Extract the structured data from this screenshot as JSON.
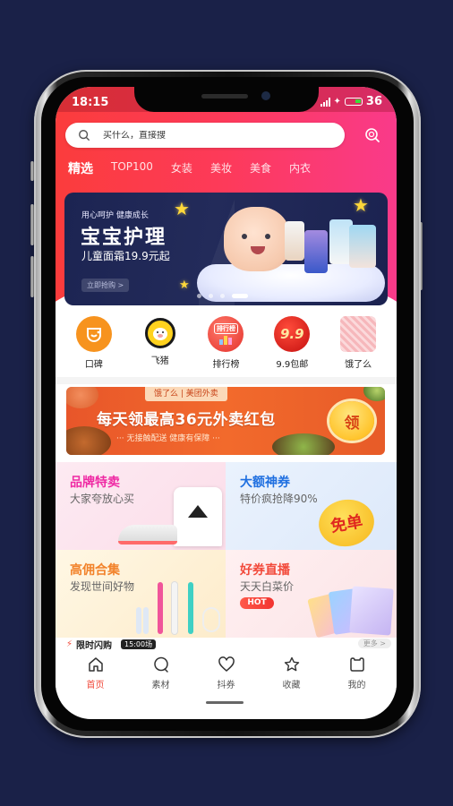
{
  "status_bar": {
    "time": "18:15",
    "battery": "36"
  },
  "search": {
    "placeholder": "买什么，直接搜"
  },
  "category_tabs": [
    {
      "label": "精选",
      "active": true
    },
    {
      "label": "TOP100"
    },
    {
      "label": "女装"
    },
    {
      "label": "美妆"
    },
    {
      "label": "美食"
    },
    {
      "label": "内衣"
    }
  ],
  "banner": {
    "eyebrow": "用心呵护 健康成长",
    "title": "宝宝护理",
    "subtitle": "儿童面霜19.9元起",
    "cta": "立即抢购 >",
    "slide_count": 4,
    "active_slide": 4
  },
  "quick_icons": [
    {
      "label": "口碑",
      "icon": "koubei-icon",
      "color": "#f7931e"
    },
    {
      "label": "飞猪",
      "icon": "fliggy-icon",
      "color": "#ffd21e"
    },
    {
      "label": "排行榜",
      "icon": "ranking-icon",
      "color": "#f2453d",
      "badge": "排行榜"
    },
    {
      "label": "9.9包邮",
      "icon": "free-shipping-icon",
      "color": "#e21d1d",
      "badge": "9.9"
    },
    {
      "label": "饿了么",
      "icon": "eleme-icon",
      "color": "#f7c3c6"
    }
  ],
  "promo": {
    "tag": "饿了么 | 美团外卖",
    "title": "每天领最高36元外卖红包",
    "subtitle": "··· 无接触配送 健康有保障 ···",
    "button": "领"
  },
  "cards": [
    {
      "title": "品牌特卖",
      "subtitle": "大家夸放心买",
      "title_color": "#ef2aa4",
      "bg": "#fde3ee"
    },
    {
      "title": "大额神券",
      "subtitle": "特价疯抢降90%",
      "title_color": "#1f6fe0",
      "bg": "#e4eefb",
      "sticker": "免单"
    },
    {
      "title": "高佣合集",
      "subtitle": "发现世间好物",
      "title_color": "#f2822a",
      "bg": "#fdf1dc"
    },
    {
      "title": "好券直播",
      "subtitle": "天天白菜价",
      "title_color": "#f24a3b",
      "bg": "#fce8ea",
      "badge": "HOT"
    }
  ],
  "flash_sale": {
    "title": "限时闪购",
    "time": "15:00场",
    "more": "更多 >"
  },
  "tabbar": [
    {
      "label": "首页",
      "icon": "home-icon",
      "active": true
    },
    {
      "label": "素材",
      "icon": "chat-bubble-icon"
    },
    {
      "label": "抖券",
      "icon": "heart-icon"
    },
    {
      "label": "收藏",
      "icon": "star-icon"
    },
    {
      "label": "我的",
      "icon": "profile-icon"
    }
  ],
  "colors": {
    "accent": "#f04a3b",
    "header_start": "#fb3c3c",
    "header_end": "#f93a8a",
    "background": "#1a2148"
  }
}
